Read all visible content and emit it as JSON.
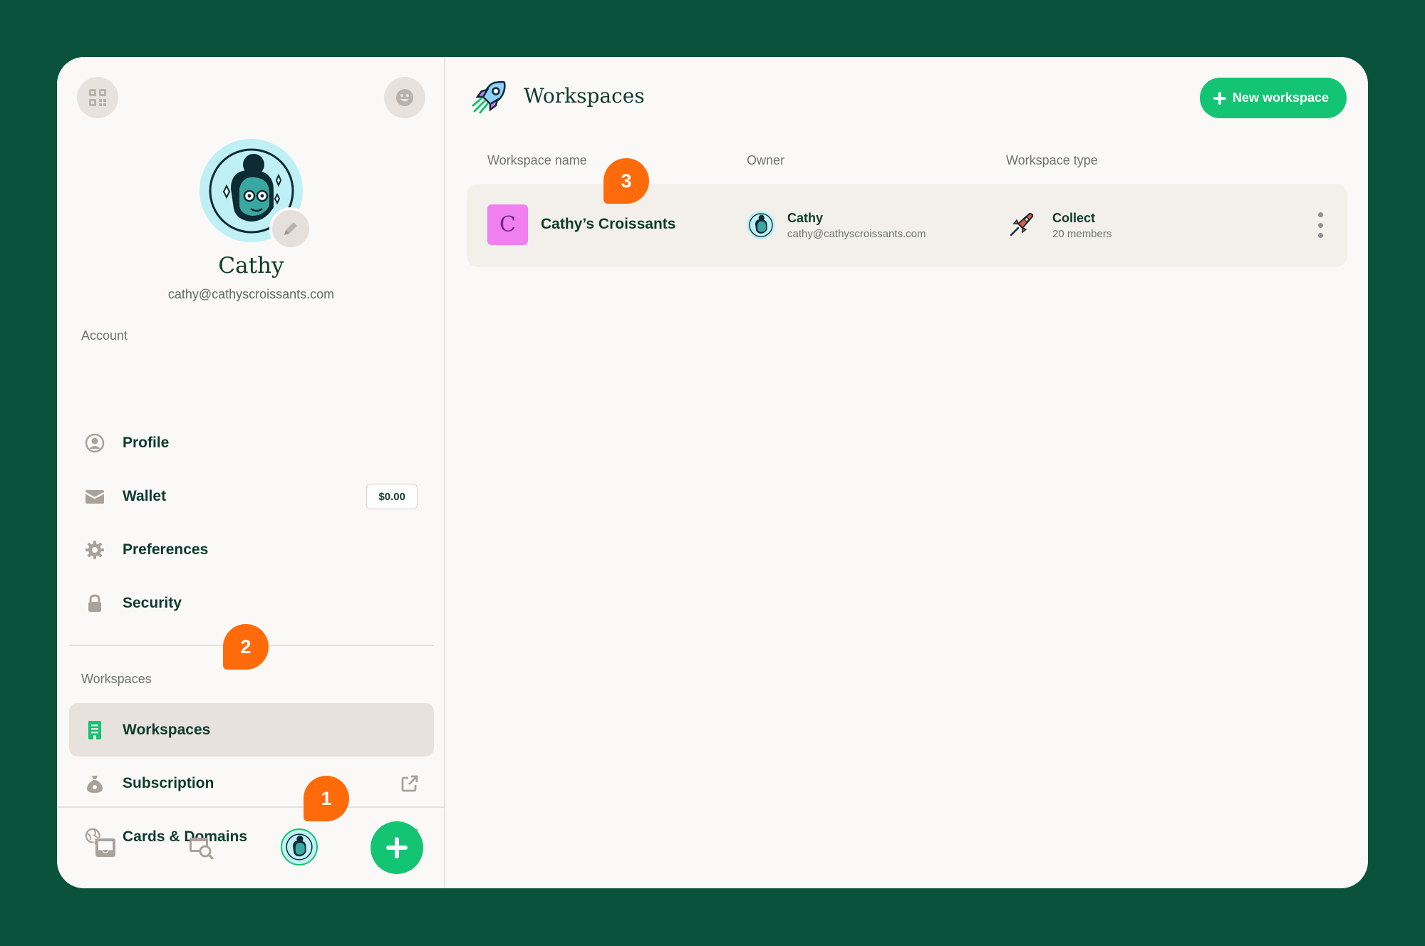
{
  "colors": {
    "background": "#0a523b",
    "panel": "#fbf9f7",
    "accent_green": "#13c472",
    "callout_orange": "#ff6b0a",
    "text_dark": "#0e3b2c"
  },
  "sidebar": {
    "top_left_icon": "qr-code-icon",
    "top_right_icon": "smiley-icon",
    "user": {
      "name": "Cathy",
      "email": "cathy@cathyscroissants.com",
      "edit_icon": "pencil-icon"
    },
    "account_section": {
      "label": "Account",
      "items": [
        {
          "label": "Profile",
          "icon": "user-circle-icon"
        },
        {
          "label": "Wallet",
          "icon": "wallet-icon",
          "badge": "$0.00"
        },
        {
          "label": "Preferences",
          "icon": "gear-icon"
        },
        {
          "label": "Security",
          "icon": "lock-icon"
        }
      ]
    },
    "workspaces_section": {
      "label": "Workspaces",
      "items": [
        {
          "label": "Workspaces",
          "icon": "building-icon",
          "active": true
        },
        {
          "label": "Subscription",
          "icon": "money-bag-icon",
          "external": true
        },
        {
          "label": "Cards & Domains",
          "icon": "globe-card-icon",
          "external": true
        }
      ]
    },
    "bottom_bar": {
      "items": [
        "inbox-icon",
        "search-browser-icon",
        "profile-avatar-icon",
        "plus-icon"
      ]
    }
  },
  "callouts": {
    "one": "1",
    "two": "2",
    "three": "3"
  },
  "main": {
    "title": "Workspaces",
    "title_icon": "rocket-icon",
    "new_button_label": "New workspace",
    "columns": [
      "Workspace name",
      "Owner",
      "Workspace type"
    ],
    "rows": [
      {
        "logo_letter": "C",
        "name": "Cathy’s Croissants",
        "owner_name": "Cathy",
        "owner_email": "cathy@cathyscroissants.com",
        "type": "Collect",
        "members": "20 members"
      }
    ]
  }
}
